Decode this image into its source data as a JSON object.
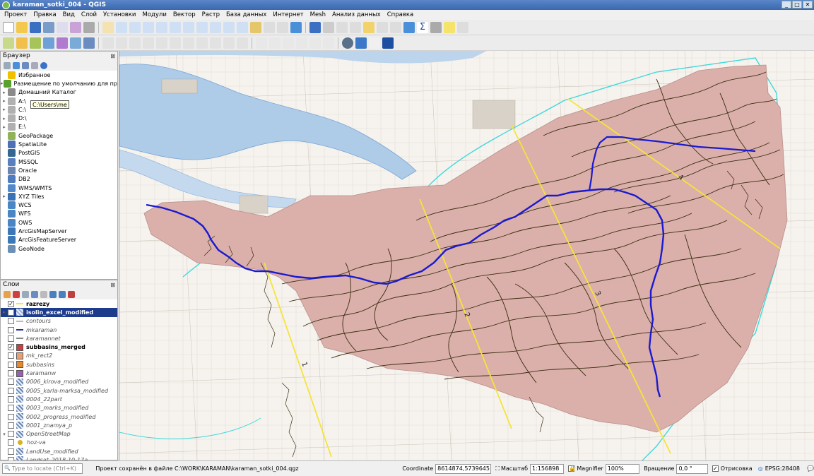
{
  "window": {
    "title": "karaman_sotki_004 - QGIS",
    "buttons": [
      "_",
      "□",
      "✕"
    ]
  },
  "menu": [
    "Проект",
    "Правка",
    "Вид",
    "Слой",
    "Установки",
    "Модули",
    "Вектор",
    "Растр",
    "База данных",
    "Интернет",
    "Mesh",
    "Анализ данных",
    "Справка"
  ],
  "browser": {
    "title": "Браузер",
    "tooltip": "C:\\Users\\me",
    "items": [
      {
        "label": "Избранное",
        "icon": "star-icon",
        "color": "#f0c000",
        "arrow": ""
      },
      {
        "label": "Размещение по умолчанию для проектов",
        "icon": "project-folder-icon",
        "color": "#5aa02c",
        "arrow": "▸"
      },
      {
        "label": "Домашний Каталог",
        "icon": "home-icon",
        "color": "#8a8a8a",
        "arrow": "▸"
      },
      {
        "label": "A:\\",
        "icon": "drive-icon",
        "color": "#b0b0b0",
        "arrow": "▸"
      },
      {
        "label": "C:\\",
        "icon": "drive-icon",
        "color": "#b0b0b0",
        "arrow": "▸"
      },
      {
        "label": "D:\\",
        "icon": "drive-icon",
        "color": "#b0b0b0",
        "arrow": "▸"
      },
      {
        "label": "E:\\",
        "icon": "drive-icon",
        "color": "#b0b0b0",
        "arrow": "▸"
      },
      {
        "label": "GeoPackage",
        "icon": "geopackage-icon",
        "color": "#8fb356",
        "arrow": ""
      },
      {
        "label": "SpatiaLite",
        "icon": "feather-icon",
        "color": "#4d6fb3",
        "arrow": ""
      },
      {
        "label": "PostGIS",
        "icon": "elephant-icon",
        "color": "#336791",
        "arrow": ""
      },
      {
        "label": "MSSQL",
        "icon": "database-icon",
        "color": "#5a7fbf",
        "arrow": ""
      },
      {
        "label": "Oracle",
        "icon": "database-icon",
        "color": "#6b84b0",
        "arrow": ""
      },
      {
        "label": "DB2",
        "icon": "database-icon",
        "color": "#4f7bbf",
        "arrow": ""
      },
      {
        "label": "WMS/WMTS",
        "icon": "globe-icon",
        "color": "#5189c9",
        "arrow": ""
      },
      {
        "label": "XYZ Tiles",
        "icon": "grid-icon",
        "color": "#3a72b8",
        "arrow": "▸"
      },
      {
        "label": "WCS",
        "icon": "globe-icon",
        "color": "#4a86c4",
        "arrow": ""
      },
      {
        "label": "WFS",
        "icon": "globe-icon",
        "color": "#4a86c4",
        "arrow": ""
      },
      {
        "label": "OWS",
        "icon": "globe-icon",
        "color": "#4a86c4",
        "arrow": ""
      },
      {
        "label": "ArcGisMapServer",
        "icon": "globe-icon",
        "color": "#3c78b8",
        "arrow": ""
      },
      {
        "label": "ArcGisFeatureServer",
        "icon": "globe-icon",
        "color": "#3c78b8",
        "arrow": ""
      },
      {
        "label": "GeoNode",
        "icon": "geonode-icon",
        "color": "#6c8fb5",
        "arrow": ""
      }
    ]
  },
  "layers": {
    "title": "Слои",
    "items": [
      {
        "label": "razrezy",
        "checked": true,
        "style": "on",
        "sym": "line",
        "color": "#f3e44a",
        "exp": ""
      },
      {
        "label": "isolin_excel_modified",
        "checked": true,
        "style": "on sel",
        "sym": "raster",
        "color": "#9cb2d8",
        "exp": "▸"
      },
      {
        "label": "contours",
        "checked": false,
        "style": "off",
        "sym": "line",
        "color": "#bbbbbb",
        "exp": ""
      },
      {
        "label": "mkaraman",
        "checked": false,
        "style": "off",
        "sym": "line",
        "color": "#2030a0",
        "exp": ""
      },
      {
        "label": "karamannet",
        "checked": false,
        "style": "off",
        "sym": "line",
        "color": "#888888",
        "exp": ""
      },
      {
        "label": "subbasins_merged",
        "checked": true,
        "style": "on",
        "sym": "fill",
        "color": "#c84040",
        "exp": ""
      },
      {
        "label": "mk_rect2",
        "checked": false,
        "style": "off",
        "sym": "fill",
        "color": "#e8a070",
        "exp": ""
      },
      {
        "label": "subbasins",
        "checked": false,
        "style": "off",
        "sym": "fill",
        "color": "#e8882c",
        "exp": ""
      },
      {
        "label": "karamanw",
        "checked": false,
        "style": "off",
        "sym": "fill",
        "color": "#9a5fb0",
        "exp": ""
      },
      {
        "label": "0006_kirova_modified",
        "checked": false,
        "style": "off",
        "sym": "raster",
        "color": "#6a86b0",
        "exp": ""
      },
      {
        "label": "0005_karla-marksa_modified",
        "checked": false,
        "style": "off",
        "sym": "raster",
        "color": "#6a86b0",
        "exp": ""
      },
      {
        "label": "0004_22part",
        "checked": false,
        "style": "off",
        "sym": "raster",
        "color": "#6a86b0",
        "exp": ""
      },
      {
        "label": "0003_marks_modified",
        "checked": false,
        "style": "off",
        "sym": "raster",
        "color": "#6a86b0",
        "exp": ""
      },
      {
        "label": "0002_progress_modified",
        "checked": false,
        "style": "off",
        "sym": "raster",
        "color": "#6a86b0",
        "exp": ""
      },
      {
        "label": "0001_znamya_p",
        "checked": false,
        "style": "off",
        "sym": "raster",
        "color": "#6a86b0",
        "exp": ""
      },
      {
        "label": "OpenStreetMap",
        "checked": false,
        "style": "off",
        "sym": "raster",
        "color": "#6a86b0",
        "exp": "▾"
      },
      {
        "label": "hoz-va",
        "checked": false,
        "style": "off",
        "sym": "point",
        "color": "#d8b020",
        "exp": ""
      },
      {
        "label": "LandUse_modified",
        "checked": false,
        "style": "off",
        "sym": "raster",
        "color": "#6a86b0",
        "exp": ""
      },
      {
        "label": "Landsat_2018-10-17a",
        "checked": false,
        "style": "off",
        "sym": "raster",
        "color": "#6a86b0",
        "exp": ""
      }
    ]
  },
  "map": {
    "section_labels": [
      "1",
      "2",
      "3",
      "4"
    ],
    "colors": {
      "basin": "#dbafaa",
      "river": "#1a1ad0",
      "contours": "#3a2e10",
      "sections": "#f5e43a",
      "boundary": "#40d8d8",
      "water": "#aecbe8"
    }
  },
  "status": {
    "locate_placeholder": "Type to locate (Ctrl+K)",
    "message": "Проект сохранён в файле C:\\WORK\\KARAMAN\\karaman_sotki_004.qgz",
    "coord_label": "Coordinate",
    "coord_value": "8614874,5739645",
    "scale_label": "Масштаб",
    "scale_value": "1:156898",
    "magnifier_label": "Magnifier",
    "magnifier_value": "100%",
    "rotation_label": "Вращение",
    "rotation_value": "0,0 °",
    "render_label": "Отрисовка",
    "crs_label": "EPSG:28408"
  }
}
